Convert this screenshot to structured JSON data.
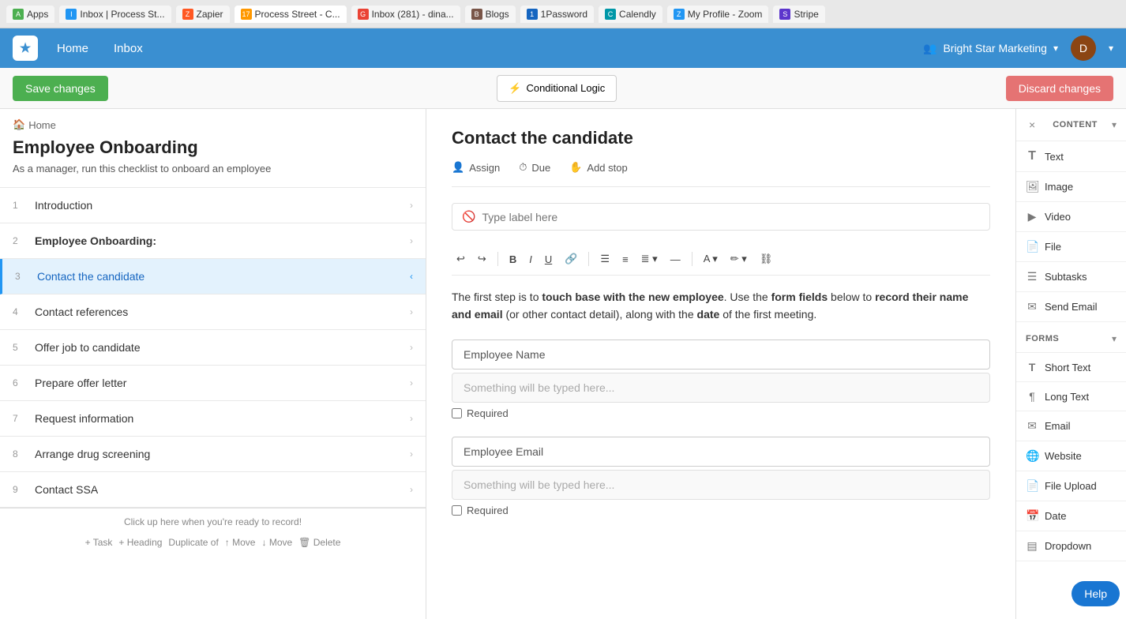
{
  "browser": {
    "tabs": [
      {
        "id": "apps",
        "label": "Apps",
        "favicon_color": "#4CAF50",
        "favicon_char": "A",
        "active": false
      },
      {
        "id": "inbox-ps",
        "label": "Inbox | Process St...",
        "favicon_color": "#2196F3",
        "favicon_char": "I",
        "active": false
      },
      {
        "id": "zapier",
        "label": "Zapier",
        "favicon_color": "#FF5722",
        "favicon_char": "Z",
        "active": false
      },
      {
        "id": "process-street",
        "label": "Process Street - C...",
        "favicon_color": "#FF9800",
        "favicon_char": "17",
        "active": true
      },
      {
        "id": "inbox-g",
        "label": "Inbox (281) - dina...",
        "favicon_color": "#EA4335",
        "favicon_char": "G",
        "active": false
      },
      {
        "id": "blogs",
        "label": "Blogs",
        "favicon_color": "#795548",
        "favicon_char": "B",
        "active": false
      },
      {
        "id": "1password",
        "label": "1Password",
        "favicon_color": "#1565C0",
        "favicon_char": "1",
        "active": false
      },
      {
        "id": "calendly",
        "label": "Calendly",
        "favicon_color": "#0097A7",
        "favicon_char": "C",
        "active": false
      },
      {
        "id": "zoom",
        "label": "My Profile - Zoom",
        "favicon_color": "#2196F3",
        "favicon_char": "Z",
        "active": false
      },
      {
        "id": "stripe",
        "label": "Stripe",
        "favicon_color": "#5C35CC",
        "favicon_char": "S",
        "active": false
      }
    ]
  },
  "nav": {
    "logo_char": "★",
    "home_label": "Home",
    "inbox_label": "Inbox",
    "org_name": "Bright Star Marketing",
    "org_icon": "👥",
    "chevron": "▾"
  },
  "toolbar": {
    "save_label": "Save changes",
    "conditional_logic_label": "Conditional Logic",
    "conditional_icon": "⚡",
    "discard_label": "Discard changes"
  },
  "sidebar": {
    "breadcrumb_icon": "🏠",
    "breadcrumb": "Home",
    "title": "Employee Onboarding",
    "description": "As a manager, run this checklist to onboard an employee",
    "tasks": [
      {
        "num": 1,
        "name": "Introduction",
        "active": false
      },
      {
        "num": 2,
        "name": "Employee Onboarding:",
        "active": false,
        "bold": true
      },
      {
        "num": 3,
        "name": "Contact the candidate",
        "active": true
      },
      {
        "num": 4,
        "name": "Contact references",
        "active": false
      },
      {
        "num": 5,
        "name": "Offer job to candidate",
        "active": false
      },
      {
        "num": 6,
        "name": "Prepare offer letter",
        "active": false
      },
      {
        "num": 7,
        "name": "Request information",
        "active": false
      },
      {
        "num": 8,
        "name": "Arrange drug screening",
        "active": false
      },
      {
        "num": 9,
        "name": "Contact SSA",
        "active": false
      }
    ],
    "bottom_hint": "Click up here when you're ready to record!",
    "bottom_actions": [
      "+ Task",
      "+ Heading",
      "Duplicate of",
      "↑ Move",
      "↓ Move",
      "🗑 Delete"
    ]
  },
  "content": {
    "task_title": "Contact the candidate",
    "meta": {
      "assign_label": "Assign",
      "assign_icon": "👤",
      "due_label": "Due",
      "due_icon": "⏱",
      "stop_label": "Add stop",
      "stop_icon": "✋"
    },
    "label_placeholder": "Type label here",
    "rte_buttons": [
      "↩",
      "↪",
      "B",
      "I",
      "U",
      "🔗",
      "☰",
      "≡",
      "≣",
      "—",
      "A",
      "✏",
      "⛓"
    ],
    "body_text_parts": [
      {
        "text": "The first step is to ",
        "bold": false
      },
      {
        "text": "touch base with the new employee",
        "bold": true
      },
      {
        "text": ". Use the ",
        "bold": false
      },
      {
        "text": "form fields",
        "bold": true
      },
      {
        "text": " below to ",
        "bold": false
      },
      {
        "text": "record their name and email",
        "bold": true
      },
      {
        "text": " (or other contact detail), along with the ",
        "bold": false
      },
      {
        "text": "date",
        "bold": true
      },
      {
        "text": " of the first meeting.",
        "bold": false
      }
    ],
    "form_fields": [
      {
        "label": "Employee Name",
        "placeholder": "Something will be typed here...",
        "required": false,
        "required_label": "Required"
      },
      {
        "label": "Employee Email",
        "placeholder": "Something will be typed here...",
        "required": false,
        "required_label": "Required"
      }
    ]
  },
  "right_panel": {
    "section_content": "CONTENT",
    "section_forms": "FORMS",
    "chevron_expand": "▾",
    "close_icon": "×",
    "content_items": [
      {
        "id": "text",
        "label": "Text",
        "icon": "T"
      },
      {
        "id": "image",
        "label": "Image",
        "icon": "🖼"
      },
      {
        "id": "video",
        "label": "Video",
        "icon": "▶"
      },
      {
        "id": "file",
        "label": "File",
        "icon": "📄"
      },
      {
        "id": "subtasks",
        "label": "Subtasks",
        "icon": "☰"
      },
      {
        "id": "send-email",
        "label": "Send Email",
        "icon": "✉"
      }
    ],
    "form_items": [
      {
        "id": "short-text",
        "label": "Short Text",
        "icon": "T"
      },
      {
        "id": "long-text",
        "label": "Long Text",
        "icon": "¶"
      },
      {
        "id": "email",
        "label": "Email",
        "icon": "✉"
      },
      {
        "id": "website",
        "label": "Website",
        "icon": "🌐"
      },
      {
        "id": "file-upload",
        "label": "File Upload",
        "icon": "📄"
      },
      {
        "id": "date",
        "label": "Date",
        "icon": "📅"
      },
      {
        "id": "dropdown",
        "label": "Dropdown",
        "icon": "▤"
      }
    ]
  },
  "help": {
    "label": "Help"
  }
}
